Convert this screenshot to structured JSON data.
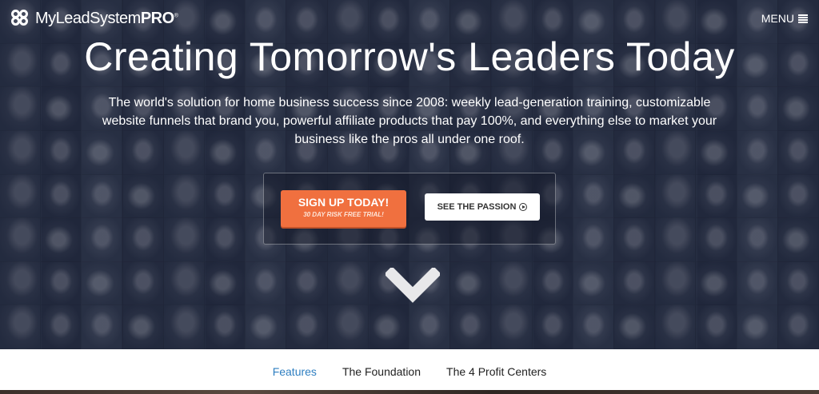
{
  "header": {
    "logo_light": "MyLeadSystem",
    "logo_bold": "PRO",
    "logo_reg": "®",
    "menu_label": "MENU"
  },
  "hero": {
    "headline": "Creating Tomorrow's Leaders Today",
    "tagline": "The world's solution for home business success since 2008: weekly lead-generation training, customizable website funnels that brand you, powerful affiliate products that pay 100%, and everything else to market your business like the pros all under one roof.",
    "signup_label": "SIGN UP TODAY!",
    "signup_sub": "30 DAY RISK FREE TRIAL!",
    "passion_label": "SEE THE PASSION"
  },
  "subnav": {
    "items": [
      {
        "label": "Features",
        "active": true
      },
      {
        "label": "The Foundation",
        "active": false
      },
      {
        "label": "The 4 Profit Centers",
        "active": false
      }
    ]
  },
  "colors": {
    "accent_orange": "#f0703f",
    "hero_overlay": "#1c243a",
    "active_link": "#2f7fc1"
  },
  "icons": [
    "logo-mark-icon",
    "hamburger-icon",
    "play-circle-icon",
    "chevron-down-icon"
  ]
}
